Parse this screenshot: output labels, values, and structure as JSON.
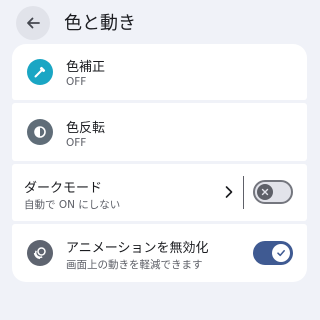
{
  "header": {
    "title": "色と動き",
    "back_icon": "arrow-back-icon"
  },
  "items": [
    {
      "title": "色補正",
      "summary": "OFF",
      "icon": "eyedropper-icon",
      "icon_color": "#1aa6c4"
    },
    {
      "title": "色反転",
      "summary": "OFF",
      "icon": "contrast-icon",
      "icon_color": "#606d78"
    },
    {
      "title": "ダークモード",
      "summary": "自動で ON にしない",
      "switch_on": false
    },
    {
      "title": "アニメーションを無効化",
      "summary": "画面上の動きを軽減できます",
      "icon": "animation-icon",
      "icon_color": "#5e6470",
      "switch_on": true
    }
  ],
  "colors": {
    "background": "#f0f2f8",
    "card": "#ffffff",
    "switch_on": "#3f5a92"
  }
}
